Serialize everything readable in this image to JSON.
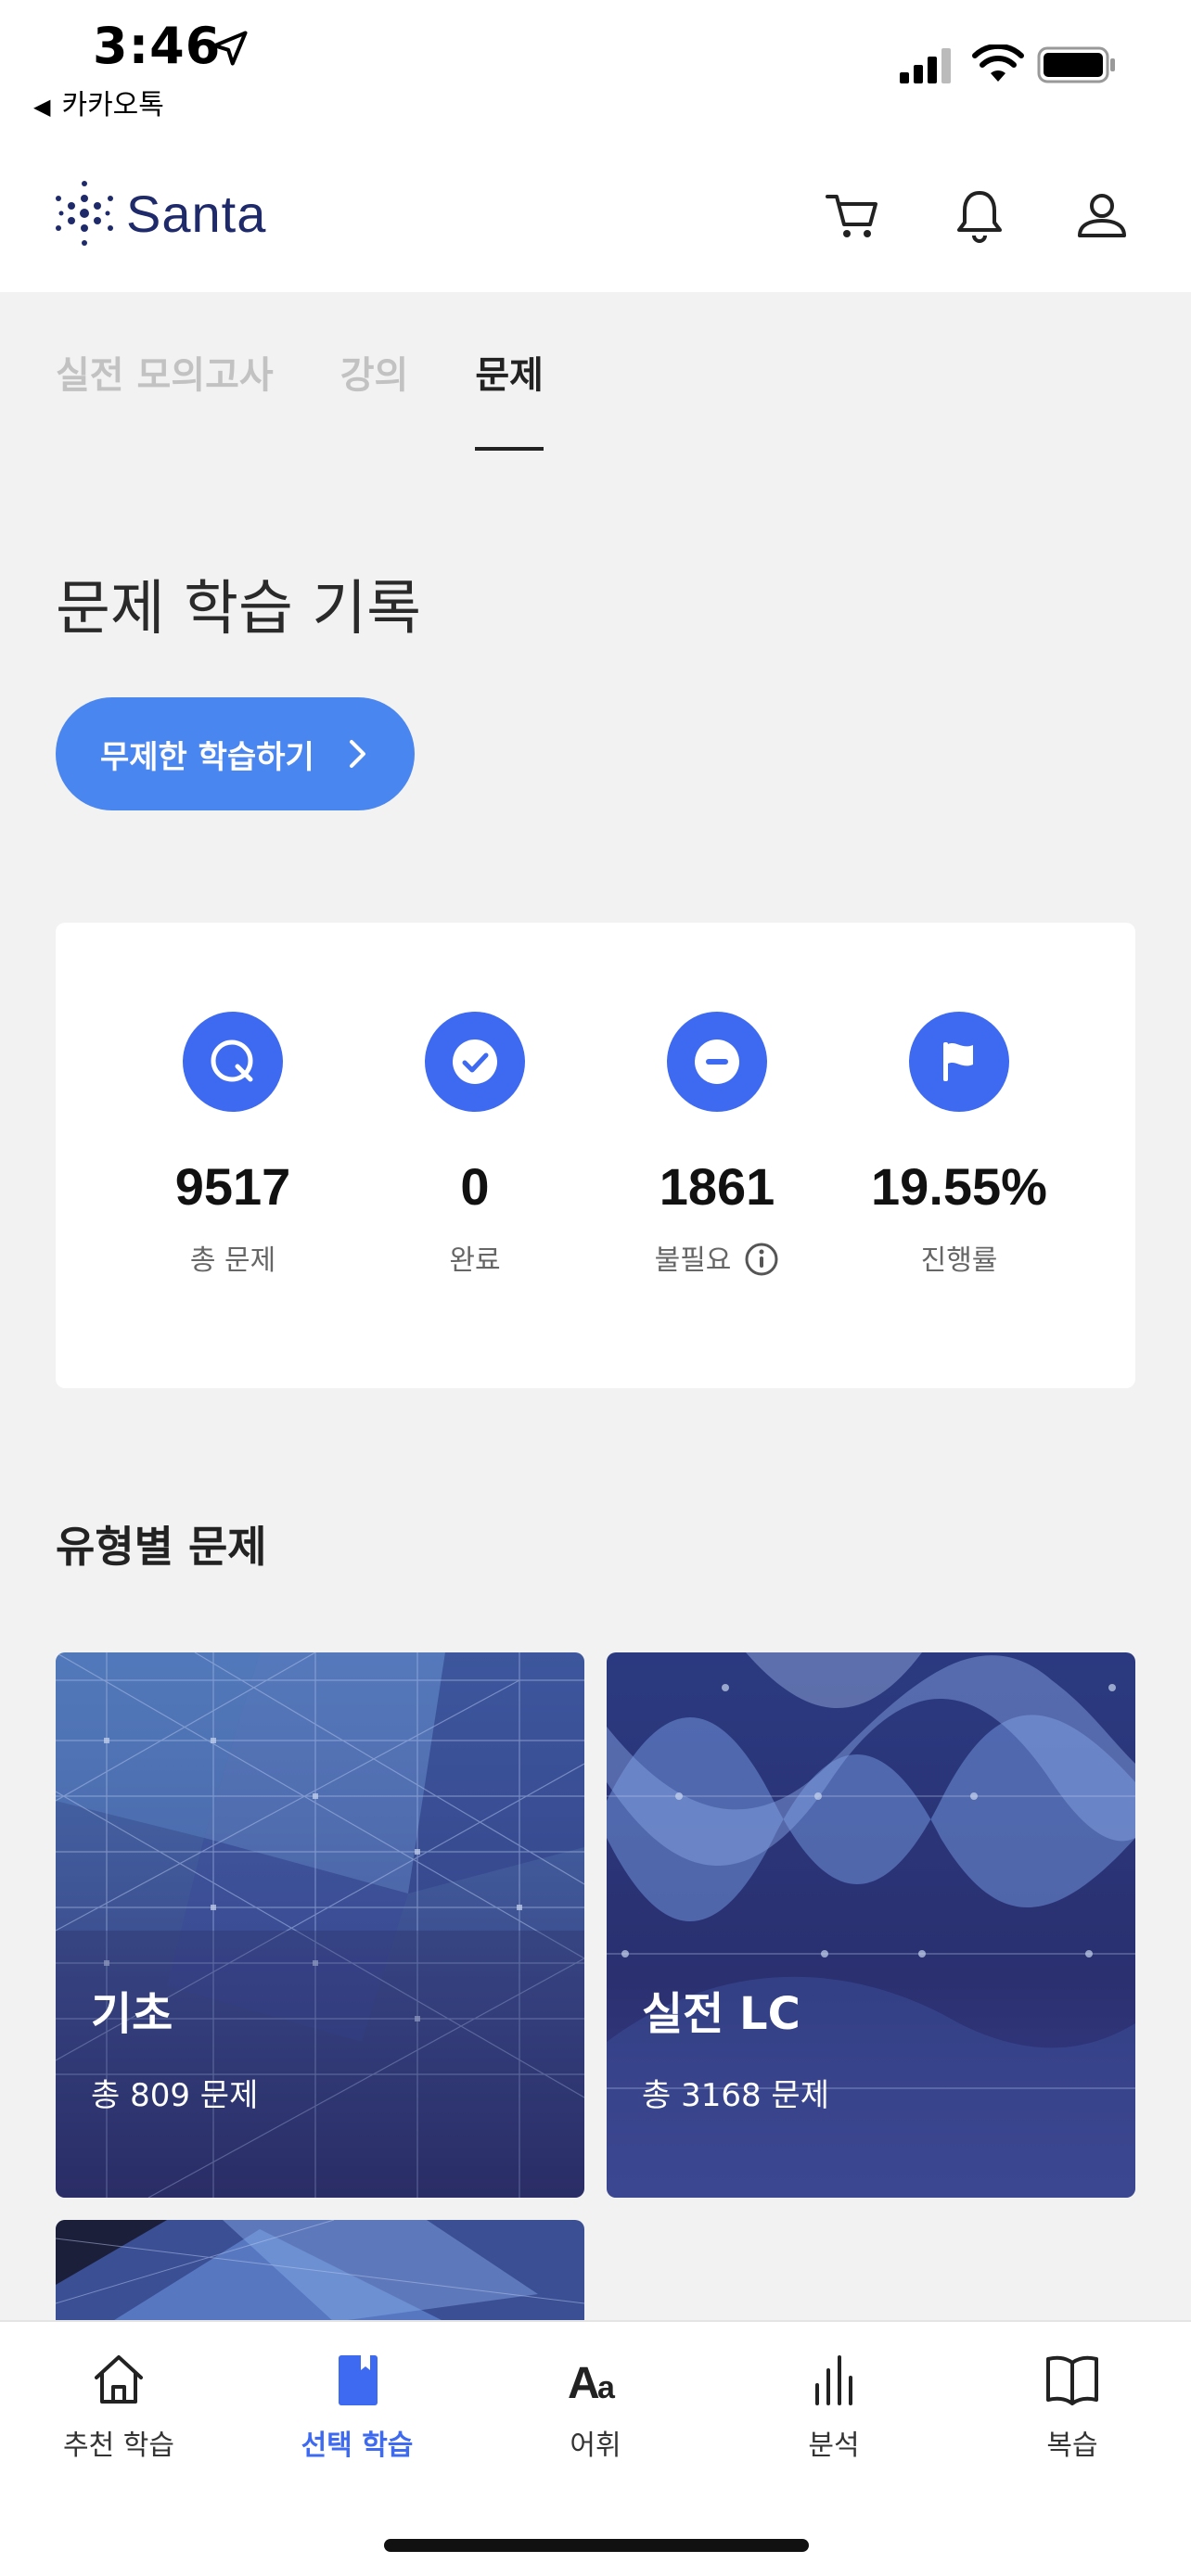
{
  "status_bar": {
    "time": "3:46",
    "back_app": "카카오톡"
  },
  "header": {
    "brand": "Santa",
    "icons": [
      "cart-icon",
      "bell-icon",
      "profile-icon"
    ]
  },
  "tabs": [
    {
      "label": "실전 모의고사",
      "active": false
    },
    {
      "label": "강의",
      "active": false
    },
    {
      "label": "문제",
      "active": true
    }
  ],
  "page_title": "문제 학습 기록",
  "cta_label": "무제한 학습하기",
  "stats": [
    {
      "icon": "q-icon",
      "value": "9517",
      "label": "총 문제"
    },
    {
      "icon": "check-icon",
      "value": "0",
      "label": "완료"
    },
    {
      "icon": "minus-icon",
      "value": "1861",
      "label": "불필요"
    },
    {
      "icon": "flag-icon",
      "value": "19.55%",
      "label": "진행률"
    }
  ],
  "section_title": "유형별 문제",
  "type_cards": [
    {
      "name": "기초",
      "count": "총 809 문제"
    },
    {
      "name": "실전 LC",
      "count": "총 3168 문제"
    }
  ],
  "bottom_nav": [
    {
      "label": "추천 학습",
      "icon": "home-icon",
      "active": false
    },
    {
      "label": "선택 학습",
      "icon": "bookmark-book-icon",
      "active": true
    },
    {
      "label": "어휘",
      "icon": "vocabulary-icon",
      "active": false
    },
    {
      "label": "분석",
      "icon": "bar-chart-icon",
      "active": false
    },
    {
      "label": "복습",
      "icon": "open-book-icon",
      "active": false
    }
  ],
  "colors": {
    "accent": "#3d6af0",
    "cta": "#4a86f0",
    "background": "#f2f2f2",
    "card_dark": "#2a3470"
  }
}
